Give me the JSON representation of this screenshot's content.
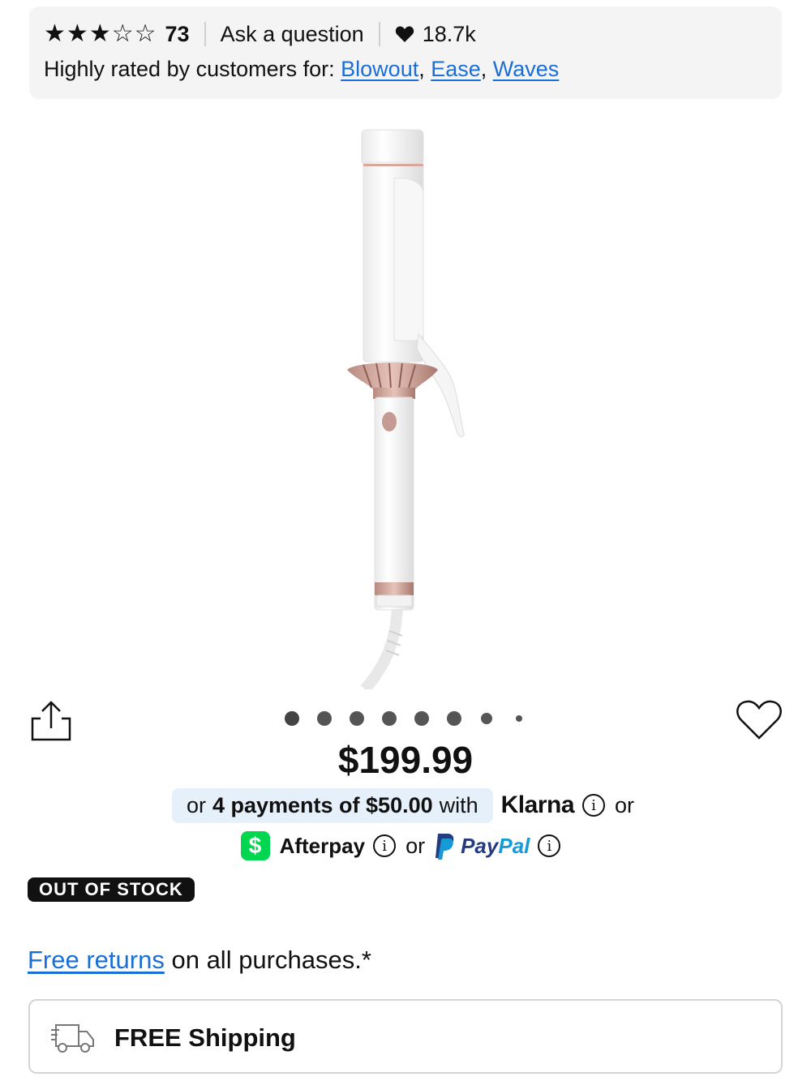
{
  "rating": {
    "stars_filled": 3,
    "stars_total": 5,
    "review_count": "73",
    "ask_label": "Ask a question",
    "loves_count": "18.7k",
    "highly_rated_prefix": "Highly rated by customers for:",
    "highly_rated_tags": [
      "Blowout",
      "Ease",
      "Waves"
    ]
  },
  "carousel": {
    "total_dots": 8,
    "active_index": 0
  },
  "product": {
    "price": "$199.99",
    "image_icon": "curling-iron-image",
    "status_badge": "OUT OF STOCK"
  },
  "payments": {
    "klarna_prefix": "or",
    "klarna_bold": "4 payments of $50.00",
    "klarna_suffix": "with",
    "klarna_brand": "Klarna",
    "or_text": "or",
    "afterpay_brand": "Afterpay",
    "paypal_pay": "Pay",
    "paypal_pal": "Pal"
  },
  "returns": {
    "link": "Free returns",
    "text": "on all purchases.*"
  },
  "shipping": {
    "label": "FREE Shipping"
  },
  "colors": {
    "link": "#1a6fd6",
    "klarna_bg": "#e6f0fb",
    "cashapp": "#00d64f",
    "paypal_dark": "#253b80",
    "paypal_light": "#179bd7",
    "badge_bg": "#111111"
  }
}
